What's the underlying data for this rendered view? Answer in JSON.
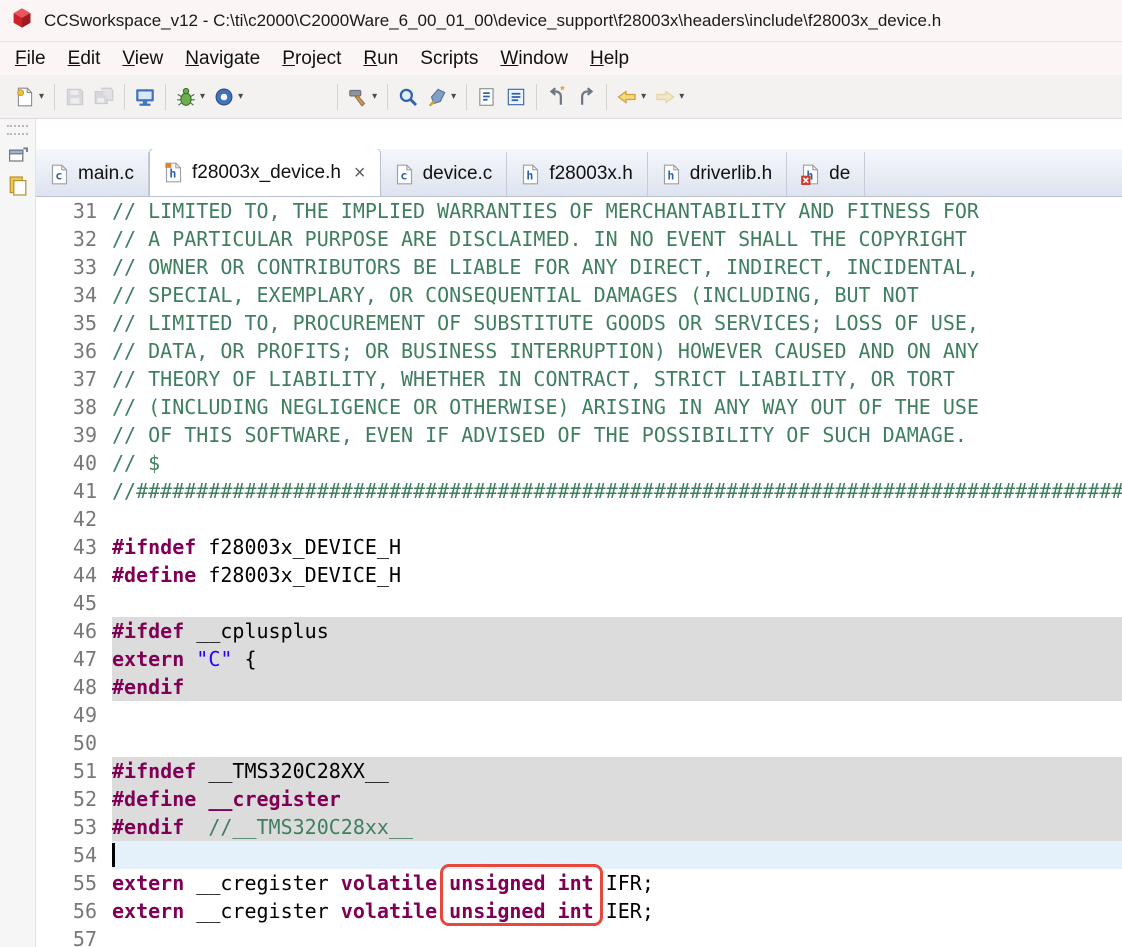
{
  "window": {
    "title": "CCSworkspace_v12 - C:\\ti\\c2000\\C2000Ware_6_00_01_00\\device_support\\f28003x\\headers\\include\\f28003x_device.h"
  },
  "menu": {
    "items": [
      {
        "label": "File",
        "m": 0
      },
      {
        "label": "Edit",
        "m": 0
      },
      {
        "label": "View",
        "m": 0
      },
      {
        "label": "Navigate",
        "m": 0
      },
      {
        "label": "Project",
        "m": 0
      },
      {
        "label": "Run",
        "m": 0
      },
      {
        "label": "Scripts",
        "m": -1
      },
      {
        "label": "Window",
        "m": 0
      },
      {
        "label": "Help",
        "m": 0
      }
    ]
  },
  "toolbar": {
    "groups": [
      {
        "items": [
          {
            "icon": "new-file",
            "caret": true
          }
        ]
      },
      {
        "items": [
          {
            "icon": "save",
            "disabled": true
          },
          {
            "icon": "save-all",
            "disabled": true
          }
        ]
      },
      {
        "items": [
          {
            "icon": "target-console"
          }
        ]
      },
      {
        "items": [
          {
            "icon": "debug",
            "caret": true
          },
          {
            "icon": "launch",
            "caret": true
          }
        ],
        "gap_after": true
      },
      {
        "items": [
          {
            "icon": "build-hammer",
            "caret": true
          }
        ]
      },
      {
        "items": [
          {
            "icon": "search"
          },
          {
            "icon": "highlighter",
            "caret": true
          }
        ]
      },
      {
        "items": [
          {
            "icon": "open-type"
          },
          {
            "icon": "outline-view"
          }
        ]
      },
      {
        "items": [
          {
            "icon": "last-edit-location"
          },
          {
            "icon": "next-edit-location"
          }
        ]
      },
      {
        "items": [
          {
            "icon": "back",
            "caret": true
          },
          {
            "icon": "forward",
            "caret": true,
            "disabled": true
          }
        ]
      }
    ]
  },
  "sidebar": {
    "icons": [
      "restore-view",
      "file-palette"
    ]
  },
  "tabs": [
    {
      "label": "main.c",
      "kind": "c"
    },
    {
      "label": "f28003x_device.h",
      "kind": "h",
      "active": true,
      "close": "×",
      "mark": "orange"
    },
    {
      "label": "device.c",
      "kind": "c"
    },
    {
      "label": "f28003x.h",
      "kind": "h"
    },
    {
      "label": "driverlib.h",
      "kind": "h"
    },
    {
      "label": "de",
      "kind": "h",
      "badge": "error"
    }
  ],
  "editor": {
    "colors": {
      "comment": "#3F7F5F",
      "keyword": "#7F0055",
      "string": "#2A00FF",
      "plain": "#000000",
      "line_number": "#787878",
      "block_highlight": "#DCDCDC",
      "current_line": "#E4F1FB",
      "annotation": "#E8473B"
    },
    "annotation": {
      "text": "unsigned int",
      "lines": [
        55,
        56
      ]
    },
    "lines": [
      {
        "n": 31,
        "seg": [
          [
            "c",
            "// LIMITED TO, THE IMPLIED WARRANTIES OF MERCHANTABILITY AND FITNESS FOR"
          ]
        ]
      },
      {
        "n": 32,
        "seg": [
          [
            "c",
            "// A PARTICULAR PURPOSE ARE DISCLAIMED. IN NO EVENT SHALL THE COPYRIGHT"
          ]
        ]
      },
      {
        "n": 33,
        "seg": [
          [
            "c",
            "// OWNER OR CONTRIBUTORS BE LIABLE FOR ANY DIRECT, INDIRECT, INCIDENTAL,"
          ]
        ]
      },
      {
        "n": 34,
        "seg": [
          [
            "c",
            "// SPECIAL, EXEMPLARY, OR CONSEQUENTIAL DAMAGES (INCLUDING, BUT NOT"
          ]
        ]
      },
      {
        "n": 35,
        "seg": [
          [
            "c",
            "// LIMITED TO, PROCUREMENT OF SUBSTITUTE GOODS OR SERVICES; LOSS OF USE,"
          ]
        ]
      },
      {
        "n": 36,
        "seg": [
          [
            "c",
            "// DATA, OR PROFITS; OR BUSINESS INTERRUPTION) HOWEVER CAUSED AND ON ANY"
          ]
        ]
      },
      {
        "n": 37,
        "seg": [
          [
            "c",
            "// THEORY OF LIABILITY, WHETHER IN CONTRACT, STRICT LIABILITY, OR TORT"
          ]
        ]
      },
      {
        "n": 38,
        "seg": [
          [
            "c",
            "// (INCLUDING NEGLIGENCE OR OTHERWISE) ARISING IN ANY WAY OUT OF THE USE"
          ]
        ]
      },
      {
        "n": 39,
        "seg": [
          [
            "c",
            "// OF THIS SOFTWARE, EVEN IF ADVISED OF THE POSSIBILITY OF SUCH DAMAGE."
          ]
        ]
      },
      {
        "n": 40,
        "seg": [
          [
            "c",
            "// $"
          ]
        ]
      },
      {
        "n": 41,
        "seg": [
          [
            "c",
            "//##########################################################################################"
          ]
        ]
      },
      {
        "n": 42,
        "seg": []
      },
      {
        "n": 43,
        "seg": [
          [
            "k",
            "#ifndef"
          ],
          [
            "p",
            " f28003x_DEVICE_H"
          ]
        ]
      },
      {
        "n": 44,
        "seg": [
          [
            "k",
            "#define"
          ],
          [
            "p",
            " f28003x_DEVICE_H"
          ]
        ]
      },
      {
        "n": 45,
        "seg": []
      },
      {
        "n": 46,
        "bg": "gray",
        "seg": [
          [
            "k",
            "#ifdef"
          ],
          [
            "p",
            " __cplusplus"
          ]
        ]
      },
      {
        "n": 47,
        "bg": "gray",
        "seg": [
          [
            "k",
            "extern"
          ],
          [
            "p",
            " "
          ],
          [
            "s",
            "\"C\""
          ],
          [
            "p",
            " {"
          ]
        ]
      },
      {
        "n": 48,
        "bg": "gray",
        "seg": [
          [
            "k",
            "#endif"
          ]
        ]
      },
      {
        "n": 49,
        "seg": []
      },
      {
        "n": 50,
        "seg": []
      },
      {
        "n": 51,
        "bg": "gray",
        "seg": [
          [
            "k",
            "#ifndef"
          ],
          [
            "p",
            " __TMS320C28XX__"
          ]
        ]
      },
      {
        "n": 52,
        "bg": "gray",
        "seg": [
          [
            "k",
            "#define"
          ],
          [
            "p",
            " "
          ],
          [
            "k",
            "__cregister"
          ]
        ]
      },
      {
        "n": 53,
        "bg": "gray",
        "seg": [
          [
            "k",
            "#endif"
          ],
          [
            "p",
            "  "
          ],
          [
            "c",
            "//__TMS320C28xx__"
          ]
        ]
      },
      {
        "n": 54,
        "bg": "cur",
        "cursor": true,
        "seg": []
      },
      {
        "n": 55,
        "seg": [
          [
            "k",
            "extern"
          ],
          [
            "p",
            " __cregister "
          ],
          [
            "k",
            "volatile"
          ],
          [
            "p",
            " "
          ],
          [
            "A",
            "unsigned int"
          ],
          [
            "p",
            " IFR;"
          ]
        ]
      },
      {
        "n": 56,
        "seg": [
          [
            "k",
            "extern"
          ],
          [
            "p",
            " __cregister "
          ],
          [
            "k",
            "volatile"
          ],
          [
            "p",
            " "
          ],
          [
            "k",
            "unsigned int"
          ],
          [
            "p",
            " IER;"
          ]
        ]
      },
      {
        "n": 57,
        "seg": []
      }
    ]
  }
}
